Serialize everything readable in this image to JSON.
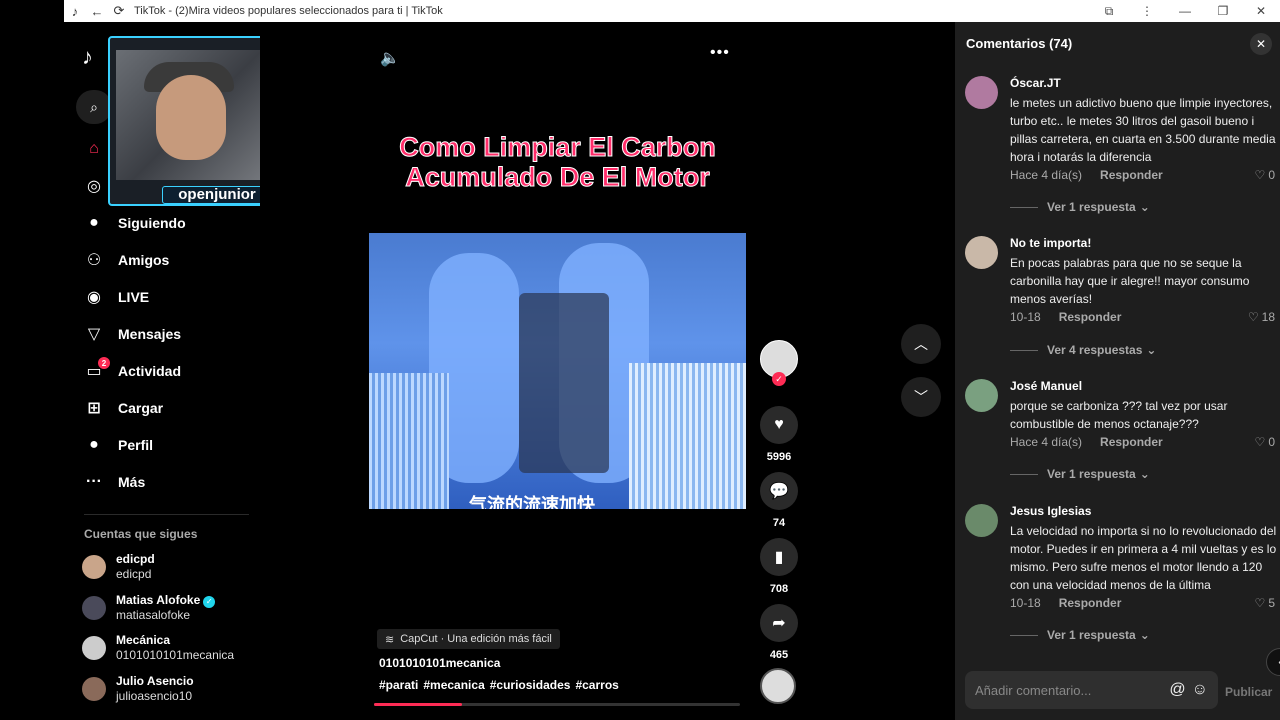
{
  "window": {
    "title": "TikTok - (2)Mira videos populares seleccionados para ti | TikTok",
    "controls": [
      "—",
      "❐",
      "✕"
    ]
  },
  "sidebar": {
    "nav": [
      {
        "label": "Para ti",
        "icon": "home-icon"
      },
      {
        "label": "Explorar",
        "icon": "compass-icon"
      },
      {
        "label": "Siguiendo",
        "icon": "following-avatar-icon"
      },
      {
        "label": "Amigos",
        "icon": "friends-icon"
      },
      {
        "label": "LIVE",
        "icon": "live-icon"
      },
      {
        "label": "Mensajes",
        "icon": "send-icon"
      },
      {
        "label": "Actividad",
        "icon": "activity-icon",
        "badge": "2"
      },
      {
        "label": "Cargar",
        "icon": "upload-icon"
      },
      {
        "label": "Perfil",
        "icon": "profile-icon"
      },
      {
        "label": "Más",
        "icon": "more-icon"
      }
    ],
    "following_title": "Cuentas que sigues",
    "accounts": [
      {
        "name": "edicpd",
        "handle": "edicpd",
        "verified": false
      },
      {
        "name": "Matias Alofoke",
        "handle": "matiasalofoke",
        "verified": true
      },
      {
        "name": "Mecánica",
        "handle": "0101010101mecanica",
        "verified": false
      },
      {
        "name": "Julio Asencio",
        "handle": "julioasencio10",
        "verified": false
      }
    ]
  },
  "webcam": {
    "handle": "openjunior"
  },
  "video": {
    "title_line1": "Como Limpiar El Carbon",
    "title_line2": "Acumulado De El Motor",
    "subtitle": "气流的流速加快",
    "capcut": "CapCut · Una edición más fácil",
    "author": "0101010101mecanica",
    "tags": [
      "#parati",
      "#mecanica",
      "#curiosidades",
      "#carros"
    ],
    "progress": 0.24,
    "likes": "5996",
    "comments": "74",
    "saves": "708",
    "shares": "465"
  },
  "comments": {
    "header": "Comentarios (74)",
    "input_placeholder": "Añadir comentario...",
    "post_label": "Publicar",
    "items": [
      {
        "user": "Óscar.JT",
        "text": "le metes un adictivo bueno que limpie inyectores, turbo etc.. le metes 30 litros del gasoil bueno i pillas carretera, en cuarta en 3.500 durante media hora i notarás la diferencia",
        "date": "Hace 4 día(s)",
        "reply": "Responder",
        "likes": "0",
        "more": "Ver 1 respuesta"
      },
      {
        "user": "No te importa!",
        "text": "En pocas palabras para que no se seque la carbonilla hay que ir alegre!! mayor consumo menos averías!",
        "date": "10-18",
        "reply": "Responder",
        "likes": "18",
        "more": "Ver 4 respuestas"
      },
      {
        "user": "José Manuel",
        "text": "porque se carboniza ??? tal vez por usar combustible de menos octanaje???",
        "date": "Hace 4 día(s)",
        "reply": "Responder",
        "likes": "0",
        "more": "Ver 1 respuesta"
      },
      {
        "user": "Jesus Iglesias",
        "text": "La velocidad no importa si no lo revolucionado del motor. Puedes ir en primera a 4 mil vueltas y es lo mismo. Pero sufre menos el motor llendo a 120 con una velocidad menos de la última",
        "date": "10-18",
        "reply": "Responder",
        "likes": "5",
        "more": "Ver 1 respuesta"
      }
    ]
  }
}
